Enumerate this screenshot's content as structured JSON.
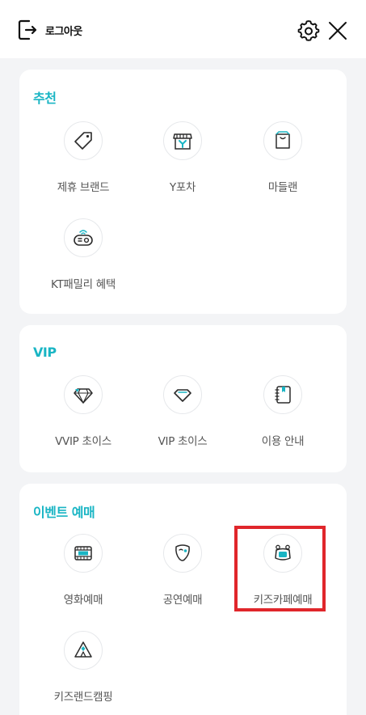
{
  "header": {
    "logout_label": "로그아웃",
    "icons": [
      "logout-icon",
      "gear-icon",
      "close-icon"
    ]
  },
  "sections": [
    {
      "title": "추천",
      "items": [
        {
          "label": "제휴 브랜드",
          "icon": "tag-icon"
        },
        {
          "label": "Y포차",
          "icon": "store-y-icon"
        },
        {
          "label": "마들랜",
          "icon": "shopping-bag-icon"
        },
        {
          "label": "KT패밀리 혜택",
          "icon": "robot-icon"
        }
      ]
    },
    {
      "title": "VIP",
      "items": [
        {
          "label": "VVIP 초이스",
          "icon": "diamond-icon"
        },
        {
          "label": "VIP 초이스",
          "icon": "diamond-outline-icon"
        },
        {
          "label": "이용 안내",
          "icon": "notebook-icon"
        }
      ]
    },
    {
      "title": "이벤트 예매",
      "items": [
        {
          "label": "영화예매",
          "icon": "film-icon"
        },
        {
          "label": "공연예매",
          "icon": "theater-mask-icon"
        },
        {
          "label": "키즈카페예매",
          "icon": "kids-cafe-icon"
        },
        {
          "label": "키즈랜드캠핑",
          "icon": "tent-icon"
        }
      ]
    }
  ],
  "colors": {
    "accent": "#19b5c4",
    "icon_stroke": "#2b2b2b",
    "highlight": "#e0262b",
    "background": "#f3f4f6"
  }
}
